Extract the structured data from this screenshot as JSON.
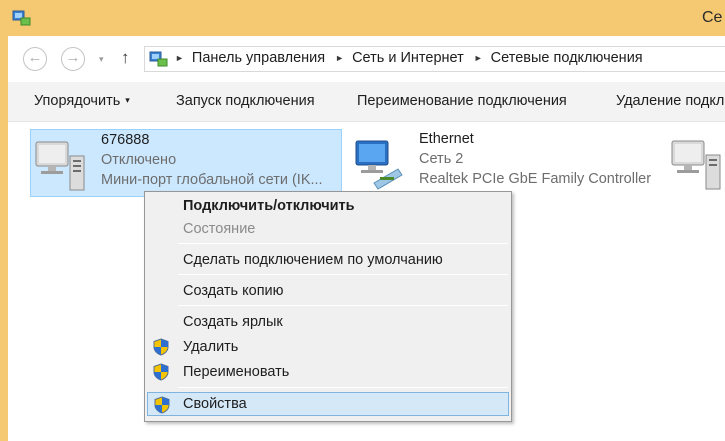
{
  "window": {
    "title": "Се",
    "accent_color": "#f5c872"
  },
  "nav": {
    "back_icon": "back-arrow-icon",
    "forward_icon": "forward-arrow-icon",
    "up_icon": "up-arrow-icon",
    "back_glyph": "←",
    "forward_glyph": "→",
    "dropdown_glyph": "▾",
    "up_glyph": "↑",
    "separator_glyph": "►",
    "breadcrumbs": [
      "Панель управления",
      "Сеть и Интернет",
      "Сетевые подключения"
    ]
  },
  "toolbar": {
    "organize": "Упорядочить",
    "organize_caret": "▾",
    "start_connection": "Запуск подключения",
    "rename_connection": "Переименование подключения",
    "delete_connection": "Удаление подкл"
  },
  "connections": [
    {
      "name": "676888",
      "status": "Отключено",
      "device": "Мини-порт глобальной сети (IK...",
      "icon": "network-adapter-icon",
      "selected": true
    },
    {
      "name": "Ethernet",
      "status": "Сеть  2",
      "device": "Realtek PCIe GbE Family Controller",
      "icon": "ethernet-adapter-icon",
      "selected": false
    },
    {
      "name": "",
      "status": "",
      "device": "",
      "icon": "network-adapter-icon",
      "selected": false
    }
  ],
  "context_menu": {
    "connect_disconnect": "Подключить/отключить",
    "status": "Состояние",
    "set_default": "Сделать подключением по умолчанию",
    "create_copy": "Создать копию",
    "create_shortcut": "Создать ярлык",
    "delete": "Удалить",
    "rename": "Переименовать",
    "properties": "Свойства",
    "highlight_color": "#d5e8f8"
  },
  "selection_color": "#cce8ff"
}
